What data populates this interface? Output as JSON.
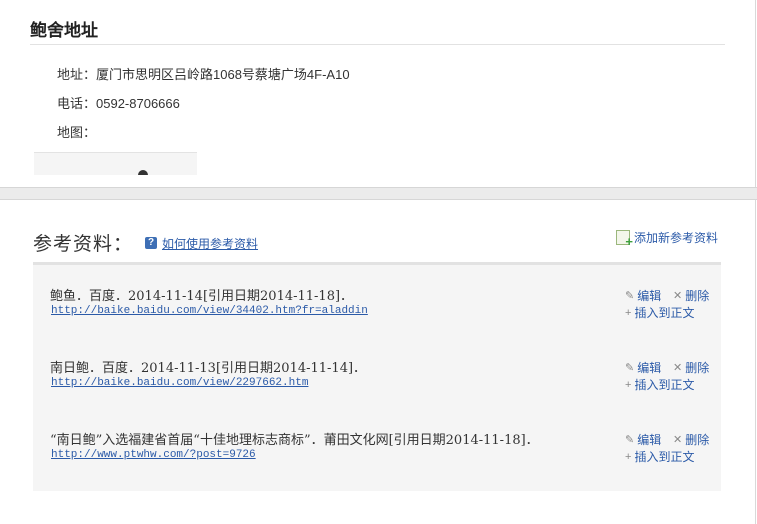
{
  "address": {
    "title": "鲍舍地址",
    "address_label": "地址：",
    "address_value": "厦门市思明区吕岭路1068号蔡塘广场4F-A10",
    "phone_label": "电话：",
    "phone_value": "0592-8706666",
    "map_label": "地图："
  },
  "references": {
    "title": "参考资料：",
    "help_link": "如何使用参考资料",
    "add_label": "添加新参考资料",
    "edit_label": "编辑",
    "delete_label": "删除",
    "insert_label": "插入到正文",
    "items": [
      {
        "text": "鲍鱼．百度．2014-11-14[引用日期2014-11-18]．",
        "url": "http://baike.baidu.com/view/34402.htm?fr=aladdin"
      },
      {
        "text": "南日鲍．百度．2014-11-13[引用日期2014-11-14]．",
        "url": "http://baike.baidu.com/view/2297662.htm"
      },
      {
        "text": "“南日鲍”入选福建省首届“十佳地理标志商标”．莆田文化网[引用日期2014-11-18]．",
        "url": "http://www.ptwhw.com/?post=9726"
      }
    ]
  },
  "colors": {
    "link": "#2b5aa8",
    "accent_green": "#3da03d"
  },
  "icons": {
    "help": "question-icon",
    "add": "add-document-icon",
    "edit": "pencil-icon",
    "delete": "x-icon",
    "insert": "plus-icon"
  }
}
